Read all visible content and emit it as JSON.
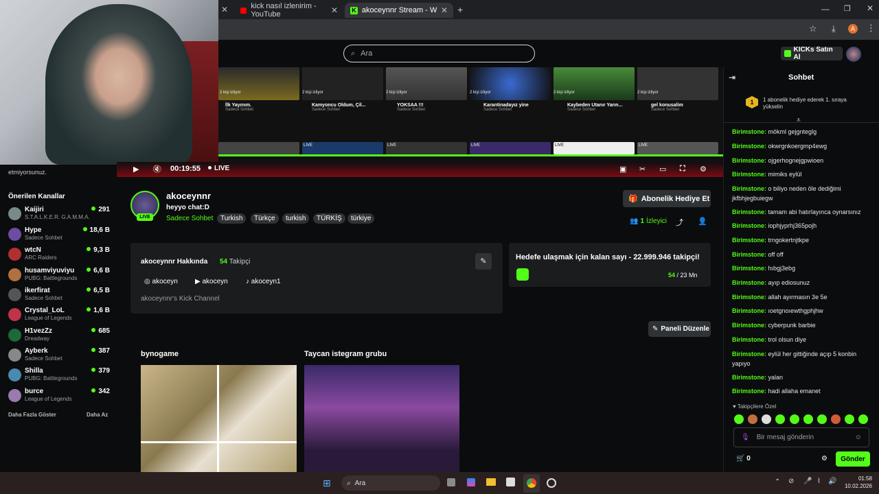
{
  "tabs": [
    {
      "title": "kick nasıl izlenirim - YouTube"
    },
    {
      "title": "akoceynnr Stream - Watch Live"
    }
  ],
  "header": {
    "search_placeholder": "Ara",
    "buy_kicks": "KICKs Satın Al"
  },
  "stream": {
    "watching_labels": [
      "2 kişi izliyor",
      "2 kişi izliyor",
      "2 kişi izliyor",
      "2 kişi izliyor",
      "2 kişi izliyor",
      "2 kişi izliyor"
    ],
    "vod_titles": [
      "İlk Yayınım.",
      "Kamyoncu Oldum, Çil...",
      "YOKSAA !!!",
      "Karantinadayız yine",
      "Kaybeden Utanır Yarın...",
      "gel konusalim"
    ],
    "vod_subs": [
      "Sadece Sohbet",
      "Sadece Sohbet",
      "Sadece Sohbet",
      "Sadece Sohbet",
      "Sadece Sohbet",
      "Sadece Sohbet"
    ],
    "live_badges": [
      "LIVE",
      "LIVE",
      "LIVE",
      "LIVE",
      "LIVE"
    ],
    "elapsed": "00:19:55",
    "live": "LIVE"
  },
  "cam_caption": "etmiyorsunuz.",
  "recommended": {
    "heading": "Önerilen Kanallar",
    "channels": [
      {
        "name": "Kaijiri",
        "game": "S.T.A.L.K.E.R. G.A.M.M.A.",
        "viewers": "291",
        "color": "#7a8a8a"
      },
      {
        "name": "Hype",
        "game": "Sadece Sohbet",
        "viewers": "18,6 B",
        "color": "#6b4ea3"
      },
      {
        "name": "wtcN",
        "game": "ARC Raiders",
        "viewers": "9,3 B",
        "color": "#b03030"
      },
      {
        "name": "husamviyuviyu",
        "game": "PUBG: Battlegrounds",
        "viewers": "6,6 B",
        "color": "#b07040"
      },
      {
        "name": "ikerfirat",
        "game": "Sadece Sohbet",
        "viewers": "6,5 B",
        "color": "#555"
      },
      {
        "name": "Crystal_LoL",
        "game": "League of Legends",
        "viewers": "1,6 B",
        "color": "#c0334a"
      },
      {
        "name": "H1vezZz",
        "game": "Dreadway",
        "viewers": "685",
        "color": "#1a6a3a"
      },
      {
        "name": "Ayberk",
        "game": "Sadece Sohbet",
        "viewers": "387",
        "color": "#888"
      },
      {
        "name": "Shilla",
        "game": "PUBG: Battlegrounds",
        "viewers": "379",
        "color": "#4a8ab0"
      },
      {
        "name": "burce",
        "game": "League of Legends",
        "viewers": "342",
        "color": "#9a7ab0"
      }
    ],
    "show_more": "Daha Fazla Göster",
    "show_less": "Daha Az"
  },
  "channel": {
    "name": "akoceynnr",
    "title": "heyyo chat:D",
    "live": "LIVE",
    "category": "Sadece Sohbet",
    "tags": [
      "Turkish",
      "Türkçe",
      "turkish",
      "TÜRKİŞ",
      "türkiye"
    ],
    "gift_sub": "Abonelik Hediye Et",
    "viewer_count": "1",
    "viewer_label": "İzleyici",
    "about_title": "akoceynnr Hakkında",
    "followers": "54",
    "followers_label": "Takipçi",
    "socials": [
      "akoceyn",
      "akoceyn",
      "akoceyn1"
    ],
    "bio": "akoceynnr's Kick Channel",
    "goal_text": "Hedefe ulaşmak için kalan sayı - 22.999.946 takipçi!",
    "goal_current": "54",
    "goal_total": "/ 23 Mn",
    "edit_panels": "Paneli Düzenle",
    "panels": [
      {
        "title": "bynogame"
      },
      {
        "title": "Taycan istegram grubu"
      }
    ]
  },
  "chat": {
    "title": "Sohbet",
    "pinned": "1 abonelik hediye ederek 1. sıraya yükselin",
    "pinned_rank": "1",
    "messages": [
      {
        "user": "Birimstone:",
        "text": "mökml gejgnteglg"
      },
      {
        "user": "Birimstone:",
        "text": "okwrgnkoergmp4ewg"
      },
      {
        "user": "Birimstone:",
        "text": "ojgerhognejgpwioen"
      },
      {
        "user": "Birimstone:",
        "text": "mimiks eylül"
      },
      {
        "user": "Birimstone:",
        "text": "o biliyo neden öle dediğimi jkfbhjegbuiegw"
      },
      {
        "user": "Birimstone:",
        "text": "tamam abi hatırlayınca oynarsınız"
      },
      {
        "user": "Birimstone:",
        "text": "iophjyprhj365pojh"
      },
      {
        "user": "Birimstone:",
        "text": "trngokertnjtkpe"
      },
      {
        "user": "Birimstone:",
        "text": "off off"
      },
      {
        "user": "Birimstone:",
        "text": "hıbgj3ebg"
      },
      {
        "user": "Birimstone:",
        "text": "ayıp ediosunuz"
      },
      {
        "user": "Birimstone:",
        "text": "allah ayırmasın 3e 5e"
      },
      {
        "user": "Birimstone:",
        "text": "ıoetgnoıewthgphjhw"
      },
      {
        "user": "Birimstone:",
        "text": "cyberpunk barbie"
      },
      {
        "user": "Birimstone:",
        "text": "trol olsun diye"
      },
      {
        "user": "Birimstone:",
        "text": "eylül her gittiğinde açıp 5 konbin yapıyo"
      },
      {
        "user": "Birimstone:",
        "text": "yalan"
      },
      {
        "user": "Birimstone:",
        "text": "hadi allaha emanet"
      }
    ],
    "follower_only": "Takipçilere Özel",
    "input_placeholder": "Bir mesaj gönderin",
    "kicks": "0",
    "send": "Gönder"
  },
  "taskbar": {
    "search": "Ara",
    "time": "01:58",
    "date": "10.02.2026"
  },
  "colors": {
    "accent": "#53fc18",
    "bg": "#0b0c0d",
    "card": "#1a1c1e"
  }
}
